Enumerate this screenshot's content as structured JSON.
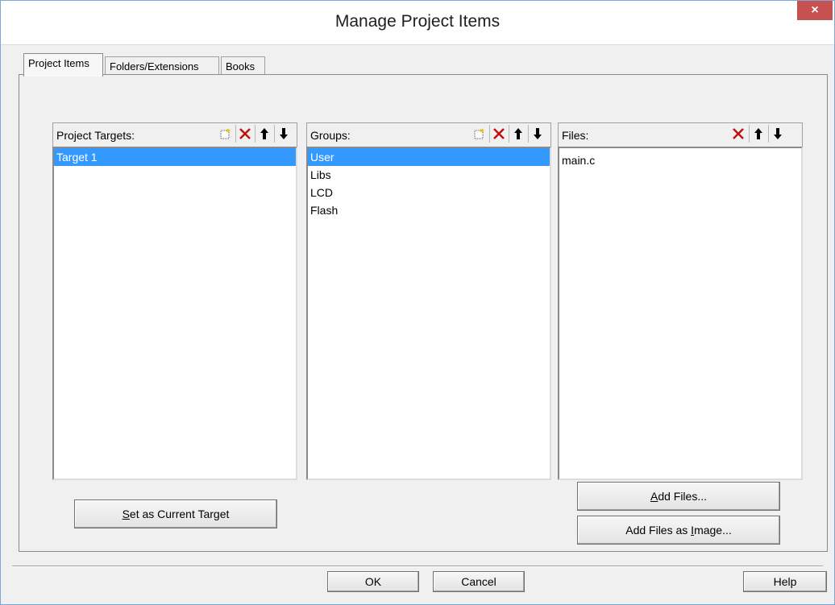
{
  "window": {
    "title": "Manage Project Items",
    "close_label": "×"
  },
  "tabs": [
    {
      "label": "Project Items",
      "active": true
    },
    {
      "label": "Folders/Extensions",
      "active": false
    },
    {
      "label": "Books",
      "active": false
    }
  ],
  "targets_pane": {
    "title": "Project Targets:",
    "items": [
      {
        "label": "Target 1",
        "selected": true
      }
    ]
  },
  "groups_pane": {
    "title": "Groups:",
    "items": [
      {
        "label": "User",
        "selected": true
      },
      {
        "label": "Libs",
        "selected": false
      },
      {
        "label": "LCD",
        "selected": false
      },
      {
        "label": "Flash",
        "selected": false
      }
    ]
  },
  "files_pane": {
    "title": "Files:",
    "items": [
      {
        "label": "main.c",
        "selected": false
      }
    ]
  },
  "buttons": {
    "set_current_target": {
      "mnemonic": "S",
      "rest": "et as Current Target"
    },
    "add_files": {
      "mnemonic": "A",
      "rest": "dd Files..."
    },
    "add_files_image": {
      "pre": "Add Files as ",
      "mnemonic": "I",
      "rest": "mage..."
    },
    "ok": "OK",
    "cancel": "Cancel",
    "help": "Help"
  },
  "colors": {
    "selection": "#3399ff",
    "close_button": "#c75050",
    "delete_icon": "#c01010"
  },
  "icons": [
    "new-item-icon",
    "delete-icon",
    "move-up-icon",
    "move-down-icon",
    "close-icon"
  ]
}
